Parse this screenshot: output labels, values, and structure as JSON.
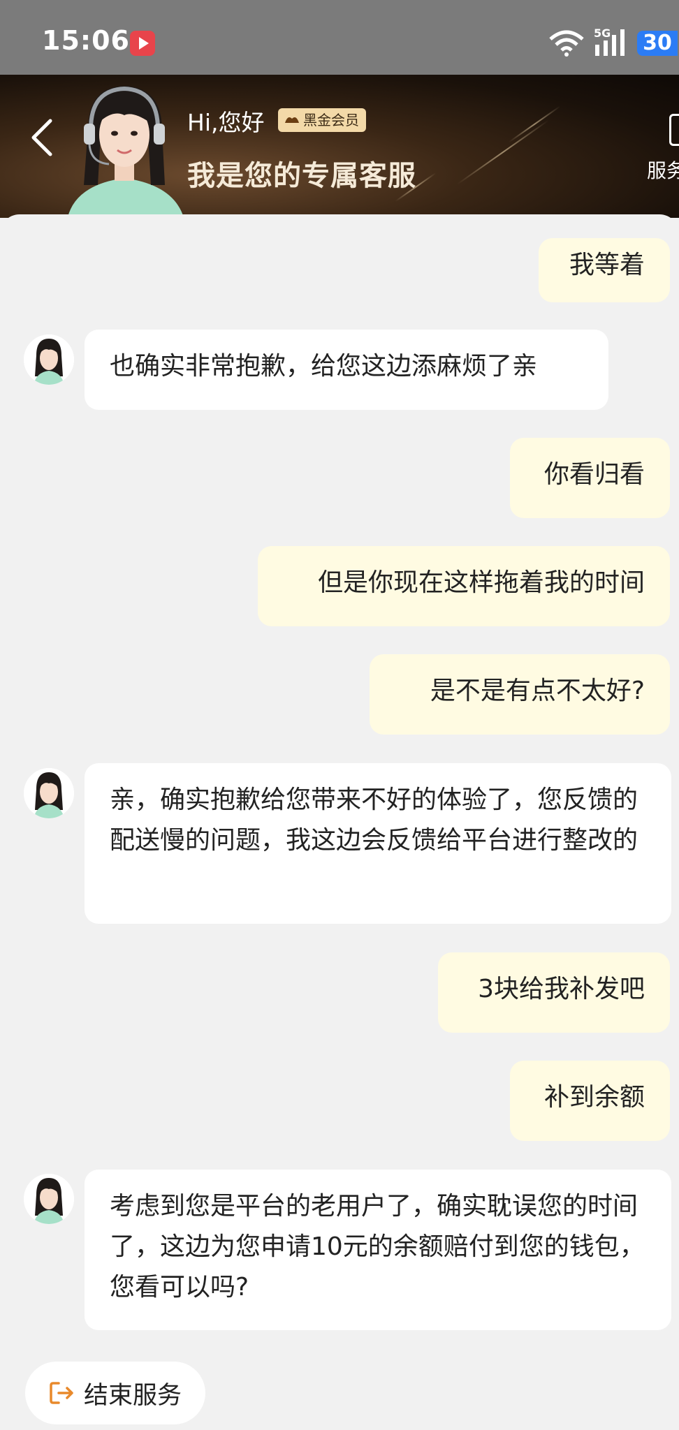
{
  "status_bar": {
    "time": "15:06",
    "network": "5G",
    "battery": "30"
  },
  "header": {
    "greeting": "Hi,您好",
    "member_badge": "黑金会员",
    "title": "我是您的专属客服",
    "service_label": "服务"
  },
  "messages": [
    {
      "role": "user",
      "text": "我等着"
    },
    {
      "role": "agent",
      "text": "也确实非常抱歉，给您这边添麻烦了亲"
    },
    {
      "role": "user",
      "text": "你看归看"
    },
    {
      "role": "user",
      "text": "但是你现在这样拖着我的时间"
    },
    {
      "role": "user",
      "text": "是不是有点不太好?"
    },
    {
      "role": "agent",
      "text": "亲，确实抱歉给您带来不好的体验了，您反馈的配送慢的问题，我这边会反馈给平台进行整改的"
    },
    {
      "role": "user",
      "text": "3块给我补发吧"
    },
    {
      "role": "user",
      "text": "补到余额"
    },
    {
      "role": "agent",
      "text": "考虑到您是平台的老用户了，确实耽误您的时间了，这边为您申请10元的余额赔付到您的钱包，您看可以吗?"
    }
  ],
  "end_service_label": "结束服务",
  "colors": {
    "user_bubble": "#fffbe2",
    "agent_bubble": "#ffffff",
    "background": "#f1f1f1",
    "badge": "#f3d9a8",
    "end_icon": "#e8892b"
  }
}
